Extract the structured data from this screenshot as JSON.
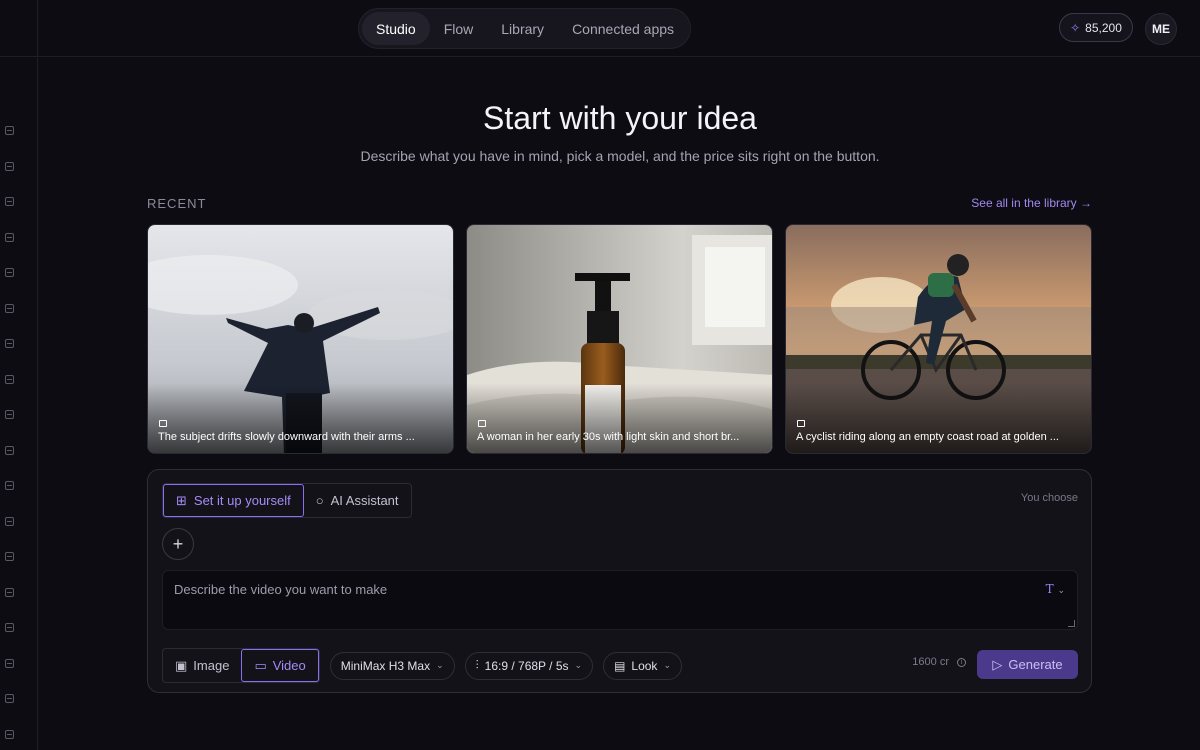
{
  "nav": {
    "tabs": [
      {
        "label": "Studio",
        "active": true
      },
      {
        "label": "Flow",
        "active": false
      },
      {
        "label": "Library",
        "active": false
      },
      {
        "label": "Connected apps",
        "active": false
      }
    ],
    "credits": "85,200",
    "avatar_initials": "ME"
  },
  "hero": {
    "title": "Start with your idea",
    "subtitle": "Describe what you have in mind, pick a model, and the price sits right on the button."
  },
  "recent": {
    "label": "RECENT",
    "see_all": "See all in the library →",
    "items": [
      {
        "caption": "The subject drifts slowly downward with their arms ..."
      },
      {
        "caption": "A woman in her early 30s with light skin and short br..."
      },
      {
        "caption": "A cyclist riding along an empty coast road at golden ..."
      }
    ]
  },
  "composer": {
    "modes": [
      "Set it up yourself",
      "AI Assistant"
    ],
    "active_mode": "Set it up yourself",
    "you_choose": "You choose",
    "add_label": "+",
    "prompt_placeholder": "Describe the video you want to make",
    "prompt_text_icon": "T",
    "types": [
      "Image",
      "Video"
    ],
    "active_type": "Video",
    "model": "MiniMax H3 Max",
    "settings": "16:9 / 768P / 5s",
    "look": "Look",
    "cost": "1600 cr",
    "generate": "Generate"
  },
  "colors": {
    "background": "#0d0c12",
    "accent": "#8a6ff0",
    "generate_button": "#4b3a8c"
  }
}
